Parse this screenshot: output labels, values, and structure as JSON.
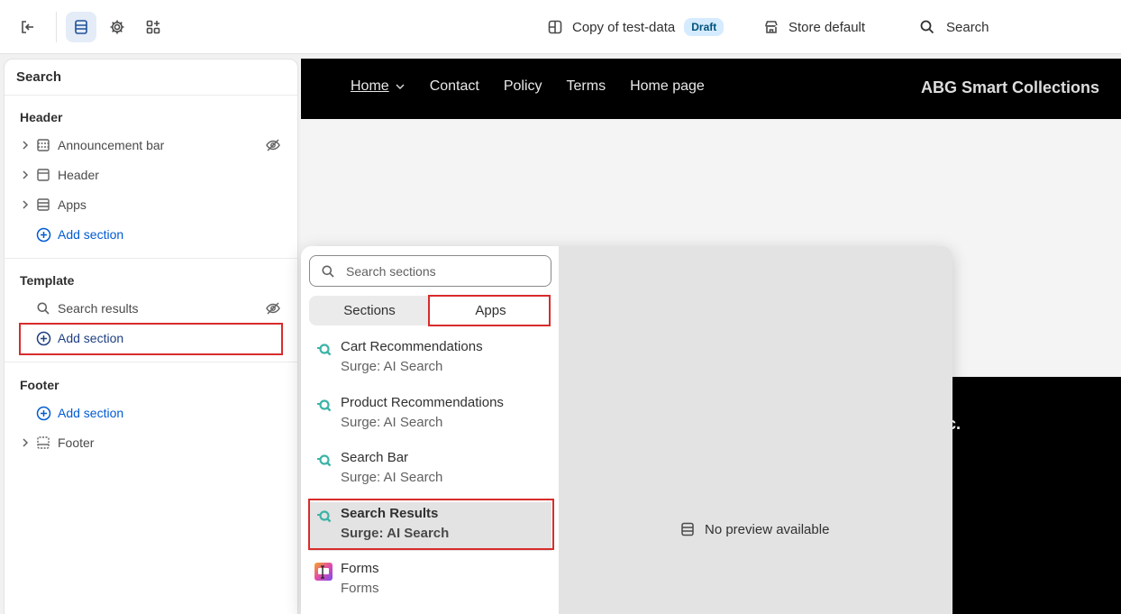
{
  "topbar": {
    "theme_name": "Copy of test-data",
    "theme_badge": "Draft",
    "store_label": "Store default",
    "search_label": "Search"
  },
  "sidebar": {
    "title": "Search",
    "header_group": {
      "title": "Header",
      "items": [
        "Announcement bar",
        "Header",
        "Apps"
      ],
      "add_label": "Add section"
    },
    "template_group": {
      "title": "Template",
      "items": [
        "Search results"
      ],
      "add_label": "Add section"
    },
    "footer_group": {
      "title": "Footer",
      "add_label": "Add section",
      "items": [
        "Footer"
      ]
    }
  },
  "preview": {
    "nav_links": [
      "Home",
      "Contact",
      "Policy",
      "Terms",
      "Home page"
    ],
    "brand": "ABG Smart Collections",
    "fragment_text": "c."
  },
  "popover": {
    "search_placeholder": "Search sections",
    "tabs": [
      "Sections",
      "Apps"
    ],
    "selected_tab": "Apps",
    "items": [
      {
        "name": "Cart Recommendations",
        "sub": "Surge: AI Search"
      },
      {
        "name": "Product Recommendations",
        "sub": "Surge: AI Search"
      },
      {
        "name": "Search Bar",
        "sub": "Surge: AI Search"
      },
      {
        "name": "Search Results",
        "sub": "Surge: AI Search"
      },
      {
        "name": "Forms",
        "sub": "Forms"
      }
    ],
    "no_preview": "No preview available"
  },
  "colors": {
    "accent_blue": "#005bd3",
    "highlight_red": "#d72c2c",
    "surge_teal": "#3cb4a6"
  }
}
